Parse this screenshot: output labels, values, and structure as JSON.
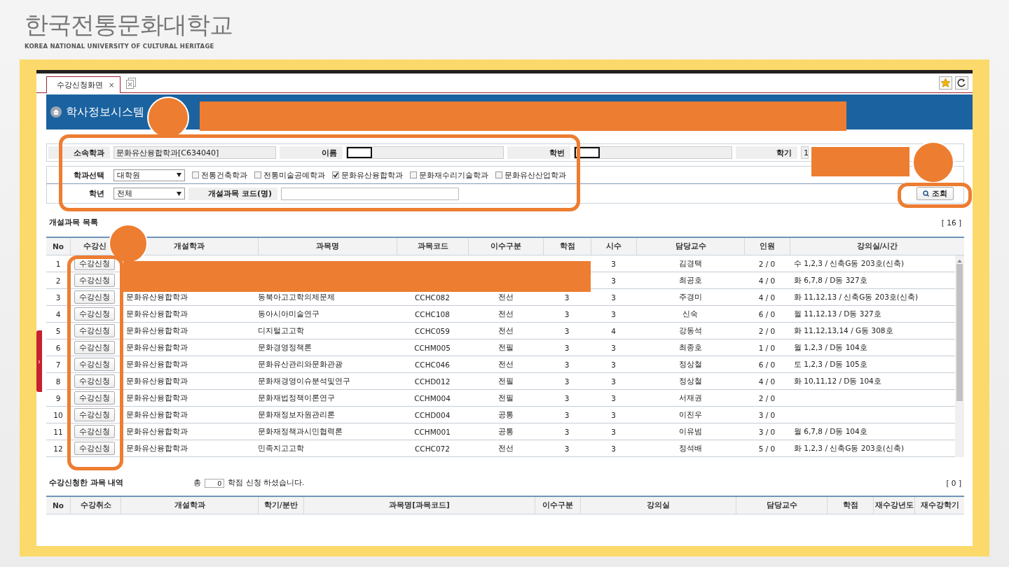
{
  "logo": {
    "name": "한국전통문화대학교",
    "subtitle": "KOREA NATIONAL UNIVERSITY OF CULTURAL HERITAGE"
  },
  "tabs": [
    {
      "label": "수강신청화면",
      "close": "×",
      "selected": true
    }
  ],
  "header": {
    "title": "학사정보시스템"
  },
  "info": [
    {
      "label": "소속학과",
      "value": "문화유산융합학과[C634040]"
    },
    {
      "label": "이름",
      "redacted": true
    },
    {
      "label": "학번",
      "redacted": true
    },
    {
      "label": "학기",
      "value": "1"
    }
  ],
  "filters": {
    "dept_label": "학과선택",
    "dept_select": "대학원",
    "departments": [
      {
        "label": "전통건축학과",
        "checked": false
      },
      {
        "label": "전통미술공예학과",
        "checked": false
      },
      {
        "label": "문화유산융합학과",
        "checked": true
      },
      {
        "label": "문화재수리기술학과",
        "checked": false
      },
      {
        "label": "문화유산산업학과",
        "checked": false
      }
    ],
    "grade_label": "학년",
    "grade_select": "전체",
    "code_label": "개설과목 코드(명)",
    "search_button": "조회"
  },
  "courses": {
    "title": "개설과목 목록",
    "count": "[ 16 ]",
    "columns": [
      "No",
      "수강신",
      "개설학과",
      "과목명",
      "과목코드",
      "이수구분",
      "학점",
      "시수",
      "담당교수",
      "인원",
      "강의실/시간"
    ],
    "rows": [
      {
        "no": "1",
        "action": "수강신청",
        "hours": "3",
        "professor": "김경택",
        "count": "2 / 0",
        "room": "수 1,2,3 / 신축G동 203호(신축)"
      },
      {
        "no": "2",
        "action": "수강신청",
        "hours": "3",
        "professor": "최공호",
        "count": "4 / 0",
        "room": "화 6,7,8 / D동 327호"
      },
      {
        "no": "3",
        "action": "수강신청",
        "dept": "문화유산융합학과",
        "course": "동북아고고학의제문제",
        "code": "CCHC082",
        "type": "전선",
        "credit": "3",
        "hours": "3",
        "professor": "주경미",
        "count": "4 / 0",
        "room": "화 11,12,13 / 신축G동 203호(신축)"
      },
      {
        "no": "4",
        "action": "수강신청",
        "dept": "문화유산융합학과",
        "course": "동아시아미술연구",
        "code": "CCHC108",
        "type": "전선",
        "credit": "3",
        "hours": "3",
        "professor": "신숙",
        "count": "6 / 0",
        "room": "월 11,12,13 / D동 327호"
      },
      {
        "no": "5",
        "action": "수강신청",
        "dept": "문화유산융합학과",
        "course": "디지털고고학",
        "code": "CCHC059",
        "type": "전선",
        "credit": "3",
        "hours": "4",
        "professor": "강동석",
        "count": "2 / 0",
        "room": "화 11,12,13,14 / G동 308호"
      },
      {
        "no": "6",
        "action": "수강신청",
        "dept": "문화유산융합학과",
        "course": "문화경영정책론",
        "code": "CCHM005",
        "type": "전필",
        "credit": "3",
        "hours": "3",
        "professor": "최종호",
        "count": "1 / 0",
        "room": "월 1,2,3 / D동 104호"
      },
      {
        "no": "7",
        "action": "수강신청",
        "dept": "문화유산융합학과",
        "course": "문화유산관리와문화관광",
        "code": "CCHC046",
        "type": "전선",
        "credit": "3",
        "hours": "3",
        "professor": "정상철",
        "count": "6 / 0",
        "room": "토 1,2,3 / D동 105호"
      },
      {
        "no": "8",
        "action": "수강신청",
        "dept": "문화유산융합학과",
        "course": "문화재경영이슈분석및연구",
        "code": "CCHD012",
        "type": "전필",
        "credit": "3",
        "hours": "3",
        "professor": "정상철",
        "count": "4 / 0",
        "room": "화 10,11,12 / D동 104호"
      },
      {
        "no": "9",
        "action": "수강신청",
        "dept": "문화유산융합학과",
        "course": "문화재법정책이론연구",
        "code": "CCHM004",
        "type": "전필",
        "credit": "3",
        "hours": "3",
        "professor": "서재권",
        "count": "2 / 0"
      },
      {
        "no": "10",
        "action": "수강신청",
        "dept": "문화유산융합학과",
        "course": "문화재정보자원관리론",
        "code": "CCHD004",
        "type": "공통",
        "credit": "3",
        "hours": "3",
        "professor": "이진우",
        "count": "3 / 0"
      },
      {
        "no": "11",
        "action": "수강신청",
        "dept": "문화유산융합학과",
        "course": "문화재정책과시민협력론",
        "code": "CCHM001",
        "type": "공통",
        "credit": "3",
        "hours": "3",
        "professor": "이유범",
        "count": "3 / 0",
        "room": "월 6,7,8 / D동 104호"
      },
      {
        "no": "12",
        "action": "수강신청",
        "dept": "문화유산융합학과",
        "course": "민족지고고학",
        "code": "CCHC072",
        "type": "전선",
        "credit": "3",
        "hours": "3",
        "professor": "정석배",
        "count": "5 / 0",
        "room": "화 1,2,3 / 신축G동 203호(신축)"
      }
    ]
  },
  "enrolled": {
    "title": "수강신청한 과목 내역",
    "total_prefix": "총",
    "total_value": "0",
    "total_suffix": "학점 신청 하셨습니다.",
    "count": "[ 0 ]",
    "columns": [
      "No",
      "수강취소",
      "개설학과",
      "학기/분반",
      "과목명[과목코드]",
      "이수구분",
      "강의실",
      "담당교수",
      "학점",
      "재수강년도",
      "재수강학기"
    ]
  },
  "side_tab": "›",
  "annotations": [
    {
      "kind": "circle"
    },
    {
      "kind": "bar"
    },
    {
      "kind": "frame"
    },
    {
      "kind": "bar"
    },
    {
      "kind": "circle"
    },
    {
      "kind": "frame"
    },
    {
      "kind": "circle"
    },
    {
      "kind": "frame"
    },
    {
      "kind": "bar"
    }
  ]
}
